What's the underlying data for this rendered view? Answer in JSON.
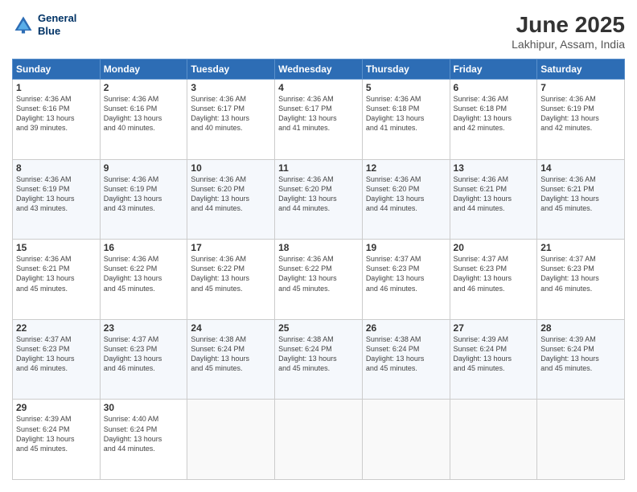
{
  "header": {
    "logo_line1": "General",
    "logo_line2": "Blue",
    "month": "June 2025",
    "location": "Lakhipur, Assam, India"
  },
  "weekdays": [
    "Sunday",
    "Monday",
    "Tuesday",
    "Wednesday",
    "Thursday",
    "Friday",
    "Saturday"
  ],
  "weeks": [
    [
      {
        "day": "1",
        "info": "Sunrise: 4:36 AM\nSunset: 6:16 PM\nDaylight: 13 hours\nand 39 minutes."
      },
      {
        "day": "2",
        "info": "Sunrise: 4:36 AM\nSunset: 6:16 PM\nDaylight: 13 hours\nand 40 minutes."
      },
      {
        "day": "3",
        "info": "Sunrise: 4:36 AM\nSunset: 6:17 PM\nDaylight: 13 hours\nand 40 minutes."
      },
      {
        "day": "4",
        "info": "Sunrise: 4:36 AM\nSunset: 6:17 PM\nDaylight: 13 hours\nand 41 minutes."
      },
      {
        "day": "5",
        "info": "Sunrise: 4:36 AM\nSunset: 6:18 PM\nDaylight: 13 hours\nand 41 minutes."
      },
      {
        "day": "6",
        "info": "Sunrise: 4:36 AM\nSunset: 6:18 PM\nDaylight: 13 hours\nand 42 minutes."
      },
      {
        "day": "7",
        "info": "Sunrise: 4:36 AM\nSunset: 6:19 PM\nDaylight: 13 hours\nand 42 minutes."
      }
    ],
    [
      {
        "day": "8",
        "info": "Sunrise: 4:36 AM\nSunset: 6:19 PM\nDaylight: 13 hours\nand 43 minutes."
      },
      {
        "day": "9",
        "info": "Sunrise: 4:36 AM\nSunset: 6:19 PM\nDaylight: 13 hours\nand 43 minutes."
      },
      {
        "day": "10",
        "info": "Sunrise: 4:36 AM\nSunset: 6:20 PM\nDaylight: 13 hours\nand 44 minutes."
      },
      {
        "day": "11",
        "info": "Sunrise: 4:36 AM\nSunset: 6:20 PM\nDaylight: 13 hours\nand 44 minutes."
      },
      {
        "day": "12",
        "info": "Sunrise: 4:36 AM\nSunset: 6:20 PM\nDaylight: 13 hours\nand 44 minutes."
      },
      {
        "day": "13",
        "info": "Sunrise: 4:36 AM\nSunset: 6:21 PM\nDaylight: 13 hours\nand 44 minutes."
      },
      {
        "day": "14",
        "info": "Sunrise: 4:36 AM\nSunset: 6:21 PM\nDaylight: 13 hours\nand 45 minutes."
      }
    ],
    [
      {
        "day": "15",
        "info": "Sunrise: 4:36 AM\nSunset: 6:21 PM\nDaylight: 13 hours\nand 45 minutes."
      },
      {
        "day": "16",
        "info": "Sunrise: 4:36 AM\nSunset: 6:22 PM\nDaylight: 13 hours\nand 45 minutes."
      },
      {
        "day": "17",
        "info": "Sunrise: 4:36 AM\nSunset: 6:22 PM\nDaylight: 13 hours\nand 45 minutes."
      },
      {
        "day": "18",
        "info": "Sunrise: 4:36 AM\nSunset: 6:22 PM\nDaylight: 13 hours\nand 45 minutes."
      },
      {
        "day": "19",
        "info": "Sunrise: 4:37 AM\nSunset: 6:23 PM\nDaylight: 13 hours\nand 46 minutes."
      },
      {
        "day": "20",
        "info": "Sunrise: 4:37 AM\nSunset: 6:23 PM\nDaylight: 13 hours\nand 46 minutes."
      },
      {
        "day": "21",
        "info": "Sunrise: 4:37 AM\nSunset: 6:23 PM\nDaylight: 13 hours\nand 46 minutes."
      }
    ],
    [
      {
        "day": "22",
        "info": "Sunrise: 4:37 AM\nSunset: 6:23 PM\nDaylight: 13 hours\nand 46 minutes."
      },
      {
        "day": "23",
        "info": "Sunrise: 4:37 AM\nSunset: 6:23 PM\nDaylight: 13 hours\nand 46 minutes."
      },
      {
        "day": "24",
        "info": "Sunrise: 4:38 AM\nSunset: 6:24 PM\nDaylight: 13 hours\nand 45 minutes."
      },
      {
        "day": "25",
        "info": "Sunrise: 4:38 AM\nSunset: 6:24 PM\nDaylight: 13 hours\nand 45 minutes."
      },
      {
        "day": "26",
        "info": "Sunrise: 4:38 AM\nSunset: 6:24 PM\nDaylight: 13 hours\nand 45 minutes."
      },
      {
        "day": "27",
        "info": "Sunrise: 4:39 AM\nSunset: 6:24 PM\nDaylight: 13 hours\nand 45 minutes."
      },
      {
        "day": "28",
        "info": "Sunrise: 4:39 AM\nSunset: 6:24 PM\nDaylight: 13 hours\nand 45 minutes."
      }
    ],
    [
      {
        "day": "29",
        "info": "Sunrise: 4:39 AM\nSunset: 6:24 PM\nDaylight: 13 hours\nand 45 minutes."
      },
      {
        "day": "30",
        "info": "Sunrise: 4:40 AM\nSunset: 6:24 PM\nDaylight: 13 hours\nand 44 minutes."
      },
      {
        "day": "",
        "info": ""
      },
      {
        "day": "",
        "info": ""
      },
      {
        "day": "",
        "info": ""
      },
      {
        "day": "",
        "info": ""
      },
      {
        "day": "",
        "info": ""
      }
    ]
  ]
}
